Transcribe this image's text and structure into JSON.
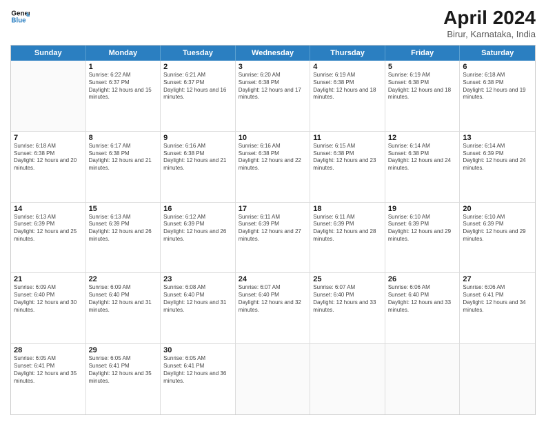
{
  "header": {
    "logo_line1": "General",
    "logo_line2": "Blue",
    "title": "April 2024",
    "subtitle": "Birur, Karnataka, India"
  },
  "weekdays": [
    "Sunday",
    "Monday",
    "Tuesday",
    "Wednesday",
    "Thursday",
    "Friday",
    "Saturday"
  ],
  "weeks": [
    [
      {
        "day": "",
        "sunrise": "",
        "sunset": "",
        "daylight": ""
      },
      {
        "day": "1",
        "sunrise": "Sunrise: 6:22 AM",
        "sunset": "Sunset: 6:37 PM",
        "daylight": "Daylight: 12 hours and 15 minutes."
      },
      {
        "day": "2",
        "sunrise": "Sunrise: 6:21 AM",
        "sunset": "Sunset: 6:37 PM",
        "daylight": "Daylight: 12 hours and 16 minutes."
      },
      {
        "day": "3",
        "sunrise": "Sunrise: 6:20 AM",
        "sunset": "Sunset: 6:38 PM",
        "daylight": "Daylight: 12 hours and 17 minutes."
      },
      {
        "day": "4",
        "sunrise": "Sunrise: 6:19 AM",
        "sunset": "Sunset: 6:38 PM",
        "daylight": "Daylight: 12 hours and 18 minutes."
      },
      {
        "day": "5",
        "sunrise": "Sunrise: 6:19 AM",
        "sunset": "Sunset: 6:38 PM",
        "daylight": "Daylight: 12 hours and 18 minutes."
      },
      {
        "day": "6",
        "sunrise": "Sunrise: 6:18 AM",
        "sunset": "Sunset: 6:38 PM",
        "daylight": "Daylight: 12 hours and 19 minutes."
      }
    ],
    [
      {
        "day": "7",
        "sunrise": "Sunrise: 6:18 AM",
        "sunset": "Sunset: 6:38 PM",
        "daylight": "Daylight: 12 hours and 20 minutes."
      },
      {
        "day": "8",
        "sunrise": "Sunrise: 6:17 AM",
        "sunset": "Sunset: 6:38 PM",
        "daylight": "Daylight: 12 hours and 21 minutes."
      },
      {
        "day": "9",
        "sunrise": "Sunrise: 6:16 AM",
        "sunset": "Sunset: 6:38 PM",
        "daylight": "Daylight: 12 hours and 21 minutes."
      },
      {
        "day": "10",
        "sunrise": "Sunrise: 6:16 AM",
        "sunset": "Sunset: 6:38 PM",
        "daylight": "Daylight: 12 hours and 22 minutes."
      },
      {
        "day": "11",
        "sunrise": "Sunrise: 6:15 AM",
        "sunset": "Sunset: 6:38 PM",
        "daylight": "Daylight: 12 hours and 23 minutes."
      },
      {
        "day": "12",
        "sunrise": "Sunrise: 6:14 AM",
        "sunset": "Sunset: 6:38 PM",
        "daylight": "Daylight: 12 hours and 24 minutes."
      },
      {
        "day": "13",
        "sunrise": "Sunrise: 6:14 AM",
        "sunset": "Sunset: 6:39 PM",
        "daylight": "Daylight: 12 hours and 24 minutes."
      }
    ],
    [
      {
        "day": "14",
        "sunrise": "Sunrise: 6:13 AM",
        "sunset": "Sunset: 6:39 PM",
        "daylight": "Daylight: 12 hours and 25 minutes."
      },
      {
        "day": "15",
        "sunrise": "Sunrise: 6:13 AM",
        "sunset": "Sunset: 6:39 PM",
        "daylight": "Daylight: 12 hours and 26 minutes."
      },
      {
        "day": "16",
        "sunrise": "Sunrise: 6:12 AM",
        "sunset": "Sunset: 6:39 PM",
        "daylight": "Daylight: 12 hours and 26 minutes."
      },
      {
        "day": "17",
        "sunrise": "Sunrise: 6:11 AM",
        "sunset": "Sunset: 6:39 PM",
        "daylight": "Daylight: 12 hours and 27 minutes."
      },
      {
        "day": "18",
        "sunrise": "Sunrise: 6:11 AM",
        "sunset": "Sunset: 6:39 PM",
        "daylight": "Daylight: 12 hours and 28 minutes."
      },
      {
        "day": "19",
        "sunrise": "Sunrise: 6:10 AM",
        "sunset": "Sunset: 6:39 PM",
        "daylight": "Daylight: 12 hours and 29 minutes."
      },
      {
        "day": "20",
        "sunrise": "Sunrise: 6:10 AM",
        "sunset": "Sunset: 6:39 PM",
        "daylight": "Daylight: 12 hours and 29 minutes."
      }
    ],
    [
      {
        "day": "21",
        "sunrise": "Sunrise: 6:09 AM",
        "sunset": "Sunset: 6:40 PM",
        "daylight": "Daylight: 12 hours and 30 minutes."
      },
      {
        "day": "22",
        "sunrise": "Sunrise: 6:09 AM",
        "sunset": "Sunset: 6:40 PM",
        "daylight": "Daylight: 12 hours and 31 minutes."
      },
      {
        "day": "23",
        "sunrise": "Sunrise: 6:08 AM",
        "sunset": "Sunset: 6:40 PM",
        "daylight": "Daylight: 12 hours and 31 minutes."
      },
      {
        "day": "24",
        "sunrise": "Sunrise: 6:07 AM",
        "sunset": "Sunset: 6:40 PM",
        "daylight": "Daylight: 12 hours and 32 minutes."
      },
      {
        "day": "25",
        "sunrise": "Sunrise: 6:07 AM",
        "sunset": "Sunset: 6:40 PM",
        "daylight": "Daylight: 12 hours and 33 minutes."
      },
      {
        "day": "26",
        "sunrise": "Sunrise: 6:06 AM",
        "sunset": "Sunset: 6:40 PM",
        "daylight": "Daylight: 12 hours and 33 minutes."
      },
      {
        "day": "27",
        "sunrise": "Sunrise: 6:06 AM",
        "sunset": "Sunset: 6:41 PM",
        "daylight": "Daylight: 12 hours and 34 minutes."
      }
    ],
    [
      {
        "day": "28",
        "sunrise": "Sunrise: 6:05 AM",
        "sunset": "Sunset: 6:41 PM",
        "daylight": "Daylight: 12 hours and 35 minutes."
      },
      {
        "day": "29",
        "sunrise": "Sunrise: 6:05 AM",
        "sunset": "Sunset: 6:41 PM",
        "daylight": "Daylight: 12 hours and 35 minutes."
      },
      {
        "day": "30",
        "sunrise": "Sunrise: 6:05 AM",
        "sunset": "Sunset: 6:41 PM",
        "daylight": "Daylight: 12 hours and 36 minutes."
      },
      {
        "day": "",
        "sunrise": "",
        "sunset": "",
        "daylight": ""
      },
      {
        "day": "",
        "sunrise": "",
        "sunset": "",
        "daylight": ""
      },
      {
        "day": "",
        "sunrise": "",
        "sunset": "",
        "daylight": ""
      },
      {
        "day": "",
        "sunrise": "",
        "sunset": "",
        "daylight": ""
      }
    ]
  ]
}
